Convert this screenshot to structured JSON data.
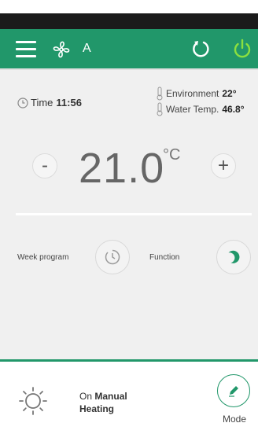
{
  "header": {
    "fan_mode": "A",
    "accent_color": "#21976a",
    "power_color": "#8be03f"
  },
  "status": {
    "time_label": "Time",
    "time_value": "11:56",
    "environment_label": "Environment",
    "environment_value": "22°",
    "water_label": "Water Temp.",
    "water_value": "46.8°"
  },
  "setpoint": {
    "value": "21.0",
    "unit": "°C",
    "minus_label": "-",
    "plus_label": "+"
  },
  "controls": {
    "week_program_label": "Week program",
    "function_label": "Function"
  },
  "footer": {
    "state_prefix": "On",
    "state_mode": "Manual",
    "state_action": "Heating",
    "mode_label": "Mode"
  },
  "icons": [
    "menu-icon",
    "fan-icon",
    "refresh-icon",
    "power-icon",
    "clock-icon",
    "thermometer-icon",
    "minus-icon",
    "plus-icon",
    "schedule-icon",
    "moon-icon",
    "sun-icon",
    "pencil-icon"
  ]
}
